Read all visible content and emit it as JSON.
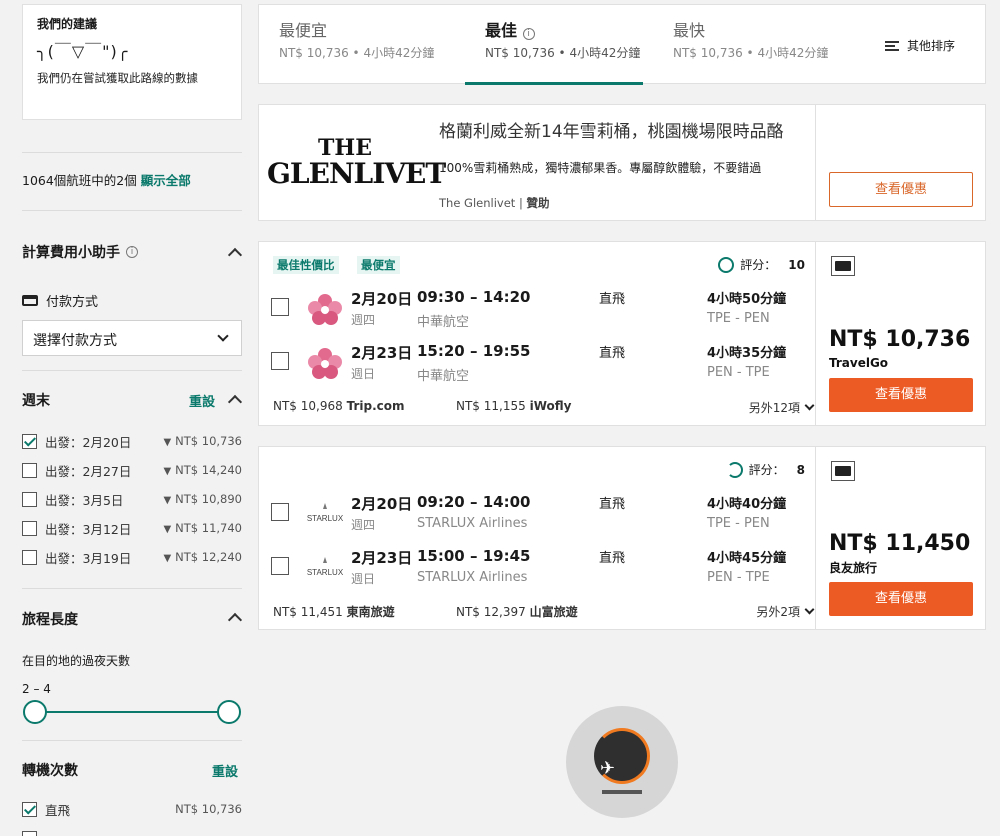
{
  "sidebar": {
    "recommendation": {
      "title": "我們的建議",
      "face": "╮(￣▽￣\")╭",
      "text": "我們仍在嘗試獲取此路線的數據"
    },
    "flight_count": {
      "prefix": "1064個航班中的2個",
      "link": "顯示全部"
    },
    "cost_helper": {
      "title": "計算費用小助手",
      "payment_label": "付款方式",
      "payment_select": "選擇付款方式"
    },
    "weekend": {
      "title": "週末",
      "reset": "重設",
      "options": [
        {
          "label": "出發：2月20日",
          "price": "NT$ 10,736",
          "checked": true
        },
        {
          "label": "出發：2月27日",
          "price": "NT$ 14,240",
          "checked": false
        },
        {
          "label": "出發：3月5日",
          "price": "NT$ 10,890",
          "checked": false
        },
        {
          "label": "出發：3月12日",
          "price": "NT$ 11,740",
          "checked": false
        },
        {
          "label": "出發：3月19日",
          "price": "NT$ 12,240",
          "checked": false
        }
      ]
    },
    "trip_length": {
      "title": "旅程長度",
      "subtitle": "在目的地的過夜天數",
      "range": "2 – 4",
      "min_value": 2,
      "max_value": 4
    },
    "stops": {
      "title": "轉機次數",
      "reset": "重設",
      "options": [
        {
          "label": "直飛",
          "price": "NT$ 10,736",
          "checked": true
        }
      ]
    }
  },
  "sort_tabs": [
    {
      "name": "最便宜",
      "sub": "NT$ 10,736 • 4小時42分鐘",
      "active": false
    },
    {
      "name": "最佳",
      "sub": "NT$ 10,736 • 4小時42分鐘",
      "active": true
    },
    {
      "name": "最快",
      "sub": "NT$ 10,736 • 4小時42分鐘",
      "active": false
    }
  ],
  "sort_more": "其他排序",
  "ad": {
    "logo_the": "THE",
    "logo_brand": "GLENLIVET",
    "title": "格蘭利威全新14年雪莉桶，桃園機場限時品酪",
    "desc": "100%雪莉桶熟成，獨特濃郁果香。專屬醇飲體驗，不要錯過",
    "sponsor_name": "The Glenlivet",
    "sponsor_sep": " | ",
    "sponsor_tag": "贊助",
    "button": "查看優惠"
  },
  "results": [
    {
      "badges": [
        "最佳性價比",
        "最便宜"
      ],
      "score_label": "評分：",
      "score": "10",
      "legs": [
        {
          "date": "2月20日",
          "time": "09:30 – 14:20",
          "weekday": "週四",
          "airline": "中華航空",
          "stops": "直飛",
          "duration": "4小時50分鐘",
          "route": "TPE - PEN",
          "logo": "plum-blossom-icon"
        },
        {
          "date": "2月23日",
          "time": "15:20 – 19:55",
          "weekday": "週日",
          "airline": "中華航空",
          "stops": "直飛",
          "duration": "4小時35分鐘",
          "route": "PEN - TPE",
          "logo": "plum-blossom-icon"
        }
      ],
      "other_price_1": "NT$ 10,968",
      "other_agency_1": "Trip.com",
      "other_price_2": "NT$ 11,155",
      "other_agency_2": "iWofly",
      "more": "另外12項",
      "price": "NT$ 10,736",
      "agency": "TravelGo",
      "button": "查看優惠"
    },
    {
      "badges": [],
      "score_label": "評分：",
      "score": "8",
      "legs": [
        {
          "date": "2月20日",
          "time": "09:20 – 14:00",
          "weekday": "週四",
          "airline": "STARLUX Airlines",
          "stops": "直飛",
          "duration": "4小時40分鐘",
          "route": "TPE - PEN",
          "logo": "starlux-logo"
        },
        {
          "date": "2月23日",
          "time": "15:00 – 19:45",
          "weekday": "週日",
          "airline": "STARLUX Airlines",
          "stops": "直飛",
          "duration": "4小時45分鐘",
          "route": "PEN - TPE",
          "logo": "starlux-logo"
        }
      ],
      "other_price_1": "NT$ 11,451",
      "other_agency_1": "東南旅遊",
      "other_price_2": "NT$ 12,397",
      "other_agency_2": "山富旅遊",
      "more": "另外2項",
      "price": "NT$ 11,450",
      "agency": "良友旅行",
      "button": "查看優惠"
    }
  ],
  "starlux_text": "STARLUX",
  "colors": {
    "accent": "#0b7a6c",
    "cta": "#ec5b24",
    "ad_button": "#d9672a"
  }
}
